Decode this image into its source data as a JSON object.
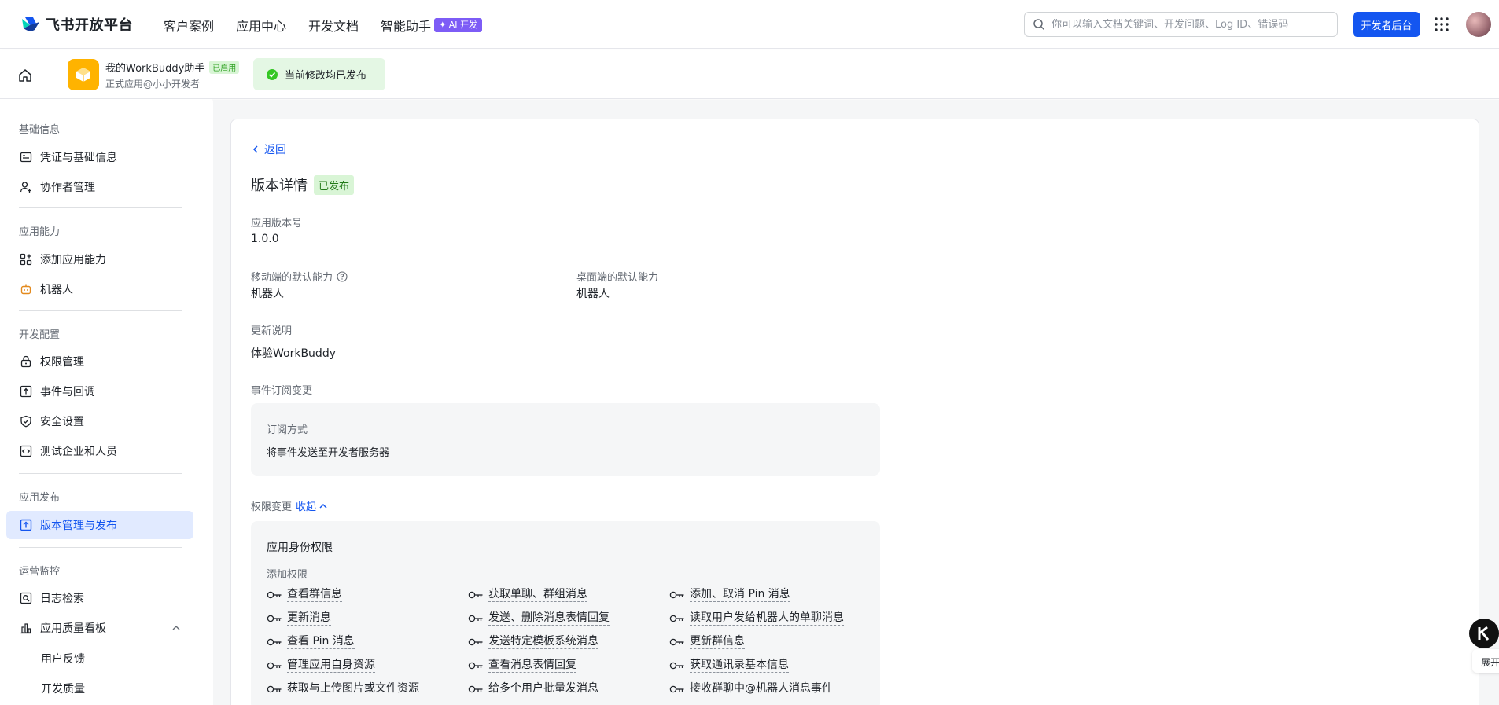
{
  "topnav": {
    "brand": "飞书开放平台",
    "links": [
      {
        "label": "客户案例"
      },
      {
        "label": "应用中心"
      },
      {
        "label": "开发文档"
      },
      {
        "label": "智能助手",
        "badge": "AI 开发"
      }
    ],
    "search_placeholder": "你可以输入文档关键词、开发问题、Log ID、错误码",
    "dev_console_label": "开发者后台"
  },
  "app": {
    "name": "我的WorkBuddy助手",
    "status_tag": "已启用",
    "subtitle": "正式应用@小小开发者",
    "publish_notice": "当前修改均已发布"
  },
  "sidebar": {
    "groups": [
      {
        "title": "基础信息",
        "items": [
          "凭证与基础信息",
          "协作者管理"
        ]
      },
      {
        "title": "应用能力",
        "items": [
          "添加应用能力",
          "机器人"
        ]
      },
      {
        "title": "开发配置",
        "items": [
          "权限管理",
          "事件与回调",
          "安全设置",
          "测试企业和人员"
        ]
      },
      {
        "title": "应用发布",
        "items": [
          "版本管理与发布"
        ]
      },
      {
        "title": "运营监控",
        "items": [
          "日志检索",
          "应用质量看板"
        ],
        "subitems": [
          "用户反馈",
          "开发质量"
        ]
      }
    ],
    "active_item": "版本管理与发布"
  },
  "detail": {
    "back_label": "返回",
    "title": "版本详情",
    "status": "已发布",
    "version_label": "应用版本号",
    "version_value": "1.0.0",
    "mobile_label": "移动端的默认能力",
    "mobile_value": "机器人",
    "desktop_label": "桌面端的默认能力",
    "desktop_value": "机器人",
    "notes_label": "更新说明",
    "notes_value": "体验WorkBuddy",
    "event_label": "事件订阅变更",
    "sub_method_label": "订阅方式",
    "sub_method_value": "将事件发送至开发者服务器",
    "perm_label": "权限变更",
    "collapse_label": "收起",
    "perm_section_title": "应用身份权限",
    "perm_added_label": "添加权限",
    "permissions": [
      [
        "查看群信息",
        "获取单聊、群组消息",
        "添加、取消 Pin 消息"
      ],
      [
        "更新消息",
        "发送、删除消息表情回复",
        "读取用户发给机器人的单聊消息"
      ],
      [
        "查看 Pin 消息",
        "发送特定模板系统消息",
        "更新群信息"
      ],
      [
        "管理应用自身资源",
        "查看消息表情回复",
        "获取通讯录基本信息"
      ],
      [
        "获取与上传图片或文件资源",
        "给多个用户批量发消息",
        "接收群聊中@机器人消息事件"
      ]
    ]
  },
  "floating": {
    "expand_label": "展开"
  },
  "colors": {
    "primary": "#1456f0",
    "success_bg": "#e4f7e4",
    "ai_badge": "#7d5cf6",
    "app_logo": "#ffb300"
  }
}
